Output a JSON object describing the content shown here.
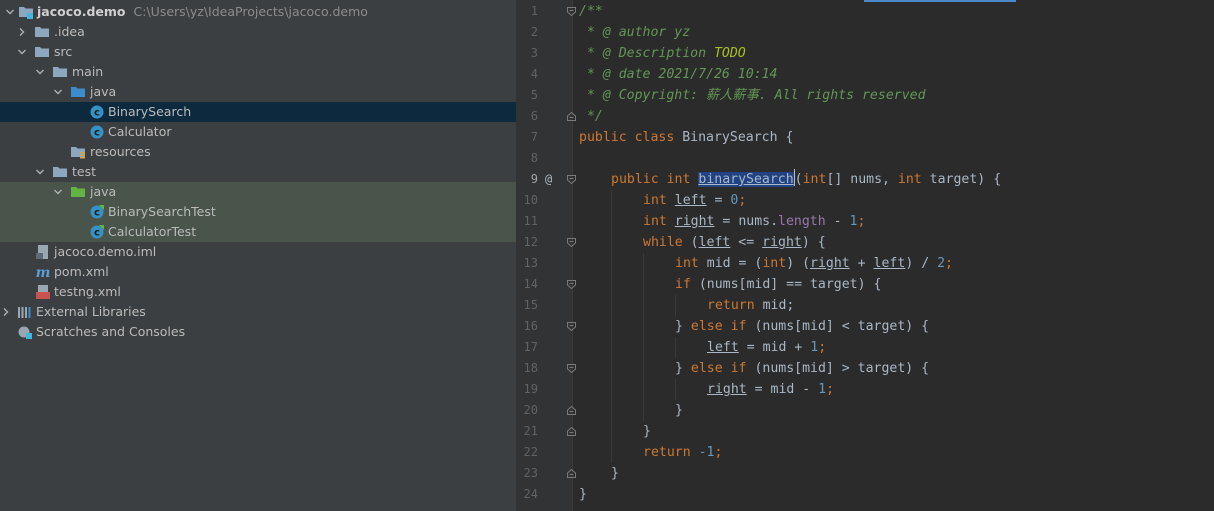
{
  "project_tree": {
    "items": [
      {
        "label": "jacoco.demo",
        "path": "C:\\Users\\yz\\IdeaProjects\\jacoco.demo",
        "icon": "module-folder-icon"
      },
      {
        "label": ".idea",
        "icon": "folder-icon"
      },
      {
        "label": "src",
        "icon": "folder-icon"
      },
      {
        "label": "main",
        "icon": "folder-icon"
      },
      {
        "label": "java",
        "icon": "source-folder-icon"
      },
      {
        "label": "BinarySearch",
        "icon": "java-class-icon"
      },
      {
        "label": "Calculator",
        "icon": "java-class-icon"
      },
      {
        "label": "resources",
        "icon": "resources-folder-icon"
      },
      {
        "label": "test",
        "icon": "folder-icon"
      },
      {
        "label": "java",
        "icon": "test-source-folder-icon"
      },
      {
        "label": "BinarySearchTest",
        "icon": "test-class-icon"
      },
      {
        "label": "CalculatorTest",
        "icon": "test-class-icon"
      },
      {
        "label": "jacoco.demo.iml",
        "icon": "iml-file-icon"
      },
      {
        "label": "pom.xml",
        "icon": "maven-icon"
      },
      {
        "label": "testng.xml",
        "icon": "testng-icon"
      },
      {
        "label": "External Libraries",
        "icon": "libraries-icon"
      },
      {
        "label": "Scratches and Consoles",
        "icon": "scratches-icon"
      }
    ]
  },
  "editor": {
    "line_numbers": [
      "1",
      "2",
      "3",
      "4",
      "5",
      "6",
      "7",
      "8",
      "9",
      "10",
      "11",
      "12",
      "13",
      "14",
      "15",
      "16",
      "17",
      "18",
      "19",
      "20",
      "21",
      "22",
      "23",
      "24"
    ],
    "gutter_mark": "@",
    "tokens": {
      "c_open": "/**",
      "c_author": " * @ author yz",
      "c_desc": " * @ Description ",
      "c_todo": "TODO",
      "c_date": " * @ date 2021/7/26 10:14",
      "c_copy": " * @ Copyright: 薪人薪事. All rights reserved",
      "c_close": " */",
      "kw_public": "public",
      "kw_class": "class",
      "kw_int": "int",
      "kw_while": "while",
      "kw_if": "if",
      "kw_else": "else",
      "kw_return": "return",
      "class_name": " BinarySearch {",
      "method_name": "binarySearch",
      "params_a": "(",
      "params_b": "[] nums, ",
      "params_c": " target) {",
      "var_left": "left",
      "var_right": "right",
      "assign": " = ",
      "num_0": "0",
      "num_1": "1",
      "num_2": "2",
      "num_neg1": "-1",
      "semi": ";",
      "nums_dot": "nums.",
      "length": "length",
      "minus": " - ",
      "plus": " + ",
      "while_a": " (",
      "while_b": " <= ",
      "while_c": ") {",
      "mid_decl": " mid = (",
      "mid_b": ") (",
      "mid_c": ") / ",
      "cond_eq": " (nums[mid] == target) {",
      "ret_mid": " mid;",
      "close_else": "} ",
      "cond_lt": " (nums[mid] < target) {",
      "cond_gt": " (nums[mid] > target) {",
      "assign_mid": " = mid",
      "brace_close": "}",
      "space": " "
    }
  }
}
